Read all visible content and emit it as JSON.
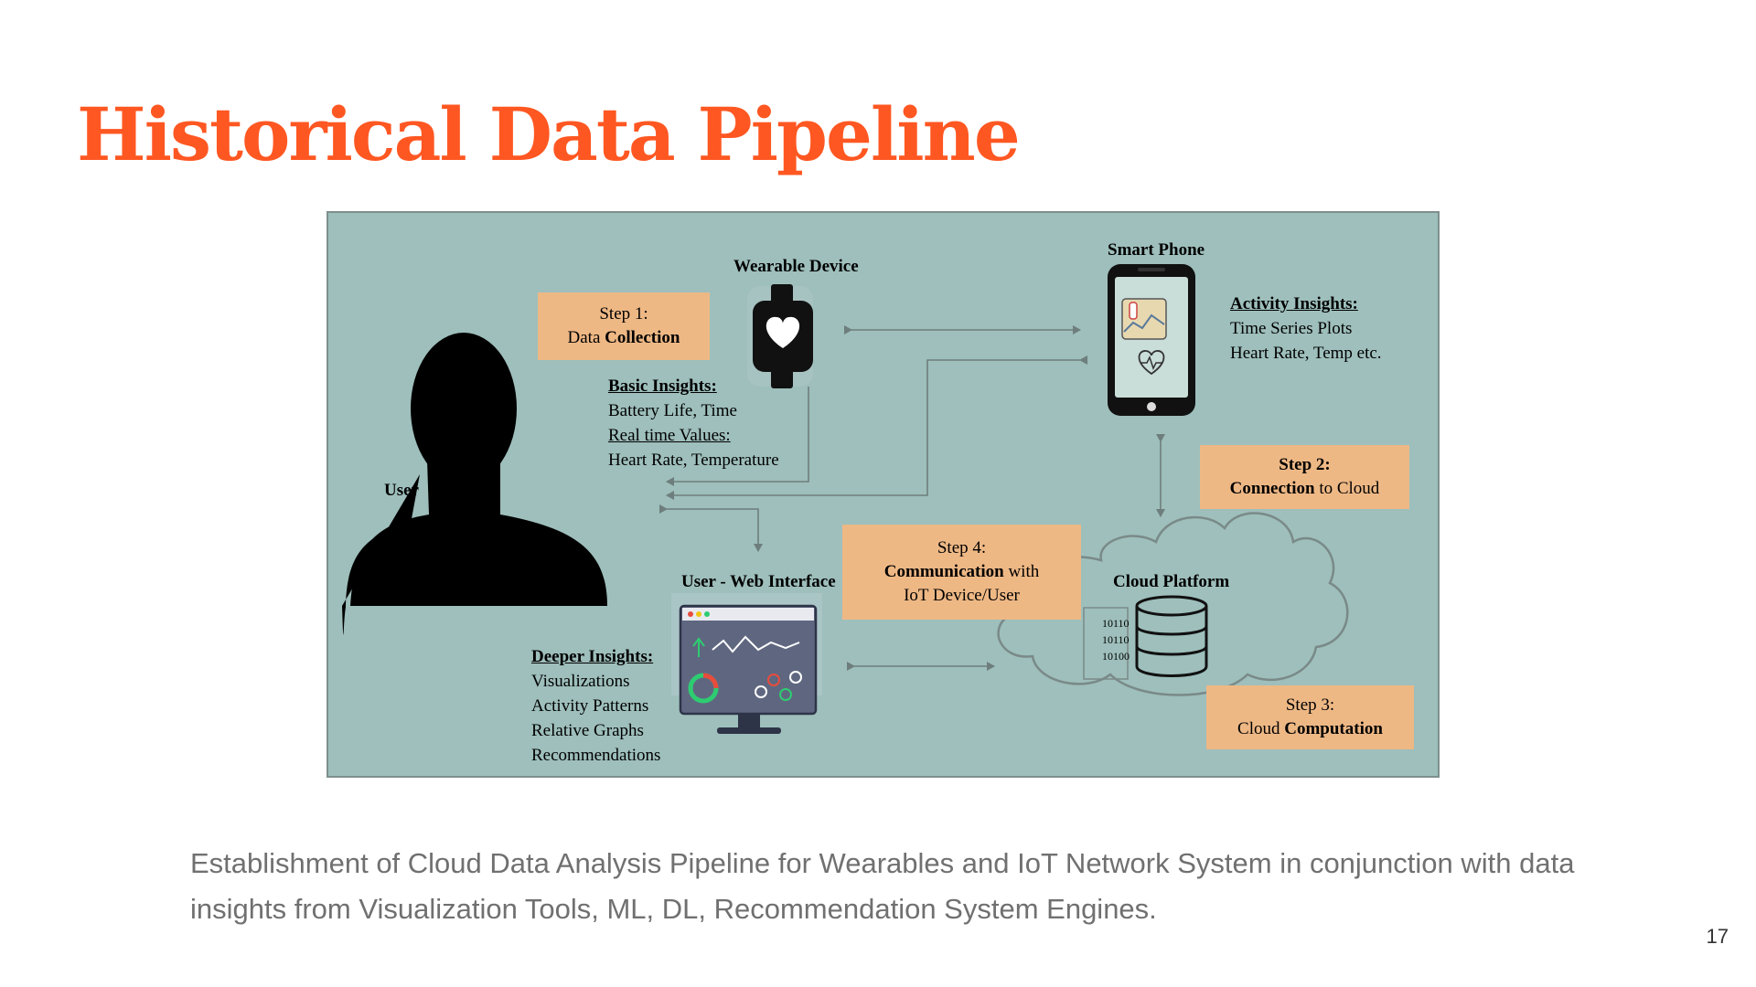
{
  "slide": {
    "title": "Historical Data Pipeline",
    "caption": "Establishment of Cloud Data Analysis Pipeline for Wearables and IoT Network System in conjunction with data insights from Visualization Tools, ML, DL, Recommendation System Engines.",
    "page_number": "17"
  },
  "diagram": {
    "user_label": "User",
    "wearable_label": "Wearable Device",
    "phone_label": "Smart Phone",
    "web_label": "User - Web Interface",
    "cloud_label": "Cloud Platform",
    "binary_lines": [
      "10110",
      "10110",
      "10100"
    ],
    "step1": {
      "line1": "Step 1:",
      "line2_pre": "Data ",
      "line2_bold": "Collection"
    },
    "step2": {
      "line1": "Step 2:",
      "line2_bold": "Connection",
      "line2_post": " to Cloud"
    },
    "step3": {
      "line1": "Step 3:",
      "line2_pre": "Cloud ",
      "line2_bold": "Computation"
    },
    "step4": {
      "line1": "Step 4:",
      "line2_bold": "Communication",
      "line2_post": " with",
      "line3": "IoT Device/User"
    },
    "basic": {
      "heading": "Basic Insights:",
      "line1": "Battery Life, Time",
      "heading2": "Real time Values:",
      "line2": "Heart Rate, Temperature"
    },
    "activity": {
      "heading": "Activity Insights:",
      "line1": "Time Series Plots",
      "line2": "Heart Rate, Temp etc."
    },
    "deeper": {
      "heading": "Deeper Insights:",
      "items": [
        "Visualizations",
        "Activity Patterns",
        "Relative Graphs",
        "Recommendations"
      ]
    },
    "colors": {
      "title": "#ff5722",
      "background": "#9ebfbc",
      "step_box": "#eeb885",
      "arrow": "#6e7e7c",
      "monitor": "#5f6780"
    },
    "icons": [
      "user-silhouette-icon",
      "smartwatch-icon",
      "smartphone-icon",
      "monitor-dashboard-icon",
      "cloud-icon",
      "database-icon"
    ]
  }
}
